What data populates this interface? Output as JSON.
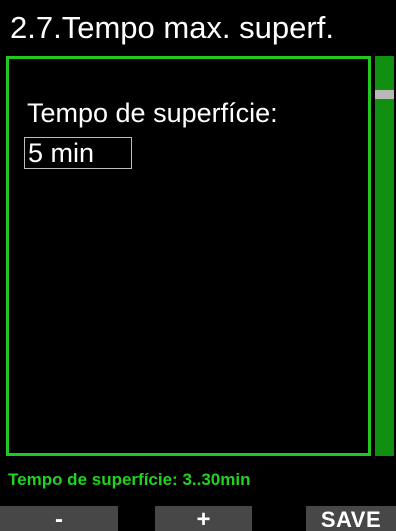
{
  "header": {
    "title": "2.7.Tempo max. superf."
  },
  "setting": {
    "label": "Tempo de superfície:",
    "value": "5 min"
  },
  "hint": {
    "text": "Tempo de superfície: 3..30min"
  },
  "softkeys": {
    "minus_label": "-",
    "plus_label": "+",
    "save_label": "SAVE"
  },
  "colors": {
    "accent": "#22c722",
    "scrollbar": "#118f11",
    "softkey_bg": "#474747"
  }
}
